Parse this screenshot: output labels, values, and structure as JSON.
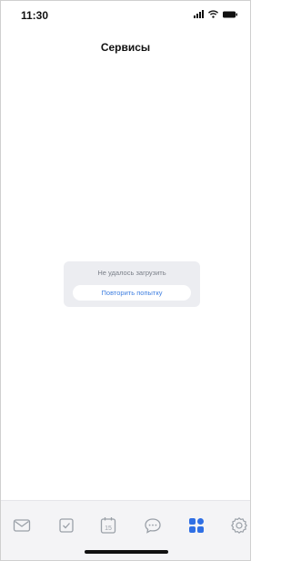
{
  "status_bar": {
    "time": "11:30",
    "icons": [
      "signal-icon",
      "wifi-icon",
      "battery-icon"
    ]
  },
  "header": {
    "title": "Сервисы"
  },
  "error": {
    "message": "Не удалось загрузить",
    "retry_label": "Повторить попытку"
  },
  "tab_bar": {
    "tabs": [
      {
        "icon": "mail-icon",
        "active": false
      },
      {
        "icon": "tasks-icon",
        "active": false
      },
      {
        "icon": "calendar-icon",
        "label": "15",
        "active": false
      },
      {
        "icon": "chat-icon",
        "active": false
      },
      {
        "icon": "services-icon",
        "active": true
      },
      {
        "icon": "settings-icon",
        "active": false
      }
    ]
  },
  "colors": {
    "accent": "#2f6fe4",
    "inactive_icon": "#9aa0a8",
    "card_background": "#ecedf1",
    "link": "#3f7fe0"
  }
}
